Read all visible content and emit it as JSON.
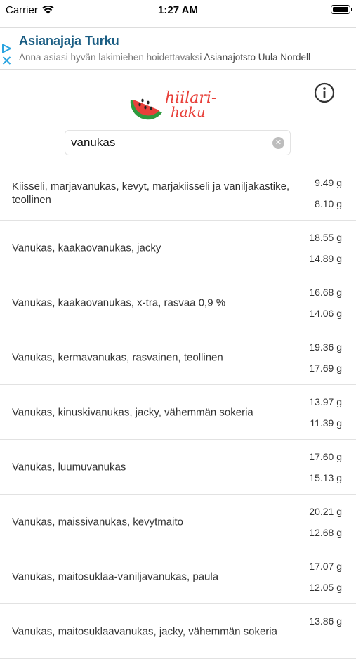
{
  "status": {
    "carrier": "Carrier",
    "time": "1:27 AM"
  },
  "ad": {
    "title": "Asianajaja Turku",
    "description": "Anna asiasi hyvän lakimiehen hoidettavaksi",
    "advertiser": "Asianajotsto Uula Nordell"
  },
  "logo": {
    "text_line1": "hiilari-",
    "text_line2": "haku"
  },
  "search": {
    "value": "vanukas"
  },
  "results": [
    {
      "name": "Kiisseli, marjavanukas, kevyt, marjakiisseli ja vaniljakastike, teollinen",
      "value1": "9.49 g",
      "value2": "8.10 g"
    },
    {
      "name": "Vanukas, kaakaovanukas, jacky",
      "value1": "18.55 g",
      "value2": "14.89 g"
    },
    {
      "name": "Vanukas, kaakaovanukas, x-tra, rasvaa 0,9 %",
      "value1": "16.68 g",
      "value2": "14.06 g"
    },
    {
      "name": "Vanukas, kermavanukas, rasvainen, teollinen",
      "value1": "19.36 g",
      "value2": "17.69 g"
    },
    {
      "name": "Vanukas, kinuskivanukas, jacky, vähemmän sokeria",
      "value1": "13.97 g",
      "value2": "11.39 g"
    },
    {
      "name": "Vanukas, luumuvanukas",
      "value1": "17.60 g",
      "value2": "15.13 g"
    },
    {
      "name": "Vanukas, maissivanukas, kevytmaito",
      "value1": "20.21 g",
      "value2": "12.68 g"
    },
    {
      "name": "Vanukas, maitosuklaa-vaniljavanukas, paula",
      "value1": "17.07 g",
      "value2": "12.05 g"
    },
    {
      "name": "Vanukas, maitosuklaavanukas, jacky, vähemmän sokeria",
      "value1": "13.86 g",
      "value2": ""
    }
  ],
  "colors": {
    "ad_title": "#1a5d83",
    "ad_icon": "#29a3e0",
    "logo_red": "#e8403a",
    "logo_green": "#2e9a3e"
  }
}
